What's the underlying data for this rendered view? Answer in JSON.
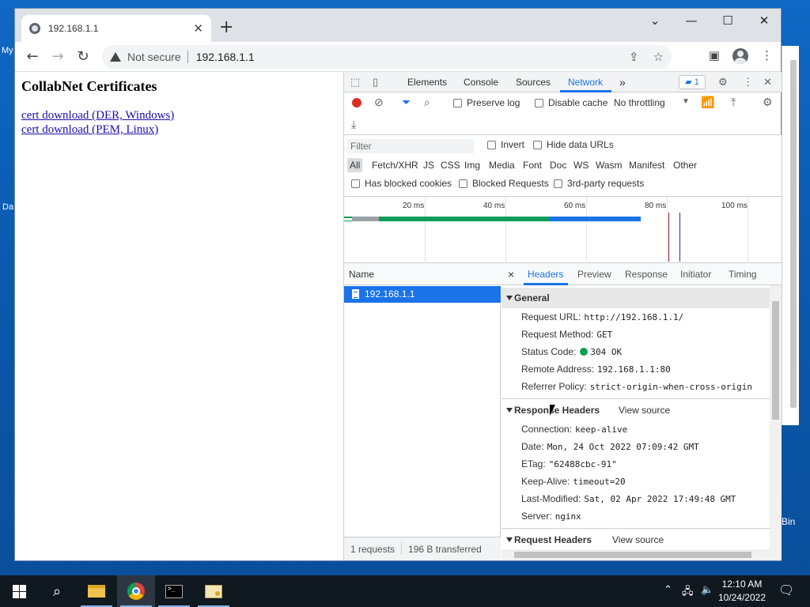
{
  "desktop": {
    "icon_labels": [
      "My",
      "Da",
      "Bin"
    ]
  },
  "browser": {
    "tab_title": "192.168.1.1",
    "new_tab_label": "+",
    "window_controls": {
      "minimize": "—",
      "maximize": "☐",
      "close": "✕",
      "tab_search": "⌄"
    },
    "security_label": "Not secure",
    "url": "192.168.1.1"
  },
  "page": {
    "heading": "CollabNet Certificates",
    "links": [
      "cert download (DER, Windows)",
      "cert download (PEM, Linux)"
    ]
  },
  "devtools": {
    "panels": [
      "Elements",
      "Console",
      "Sources",
      "Network"
    ],
    "active_panel": "Network",
    "more_panels": "»",
    "issues_count": "1",
    "toolbar": {
      "preserve_log": "Preserve log",
      "disable_cache": "Disable cache",
      "throttling": "No throttling"
    },
    "filter": {
      "placeholder": "Filter",
      "invert": "Invert",
      "hide_data_urls": "Hide data URLs",
      "types": [
        "All",
        "Fetch/XHR",
        "JS",
        "CSS",
        "Img",
        "Media",
        "Font",
        "Doc",
        "WS",
        "Wasm",
        "Manifest",
        "Other"
      ],
      "has_blocked_cookies": "Has blocked cookies",
      "blocked_requests": "Blocked Requests",
      "third_party": "3rd-party requests"
    },
    "timeline": {
      "ticks": [
        "20 ms",
        "40 ms",
        "60 ms",
        "80 ms",
        "100 ms"
      ],
      "colors": {
        "green": "#0f9d58",
        "blue": "#1a73e8",
        "grey": "#9aa0a6",
        "red": "#8b1a1a",
        "navy": "#1f3a93"
      }
    },
    "list": {
      "column_name": "Name",
      "rows": [
        "192.168.1.1"
      ],
      "footer": {
        "requests": "1 requests",
        "transferred": "196 B transferred"
      }
    },
    "details": {
      "close": "×",
      "tabs": [
        "Headers",
        "Preview",
        "Response",
        "Initiator",
        "Timing"
      ],
      "active_tab": "Headers",
      "general": {
        "title": "General",
        "rows": [
          {
            "k": "Request URL:",
            "v": "http://192.168.1.1/"
          },
          {
            "k": "Request Method:",
            "v": "GET"
          },
          {
            "k": "Status Code:",
            "v": "304 OK"
          },
          {
            "k": "Remote Address:",
            "v": "192.168.1.1:80"
          },
          {
            "k": "Referrer Policy:",
            "v": "strict-origin-when-cross-origin"
          }
        ]
      },
      "response_headers": {
        "title": "Response Headers",
        "view_source": "View source",
        "rows": [
          {
            "k": "Connection:",
            "v": "keep-alive"
          },
          {
            "k": "Date:",
            "v": "Mon, 24 Oct 2022 07:09:42 GMT"
          },
          {
            "k": "ETag:",
            "v": "\"62488cbc-91\""
          },
          {
            "k": "Keep-Alive:",
            "v": "timeout=20"
          },
          {
            "k": "Last-Modified:",
            "v": "Sat, 02 Apr 2022 17:49:48 GMT"
          },
          {
            "k": "Server:",
            "v": "nginx"
          }
        ]
      },
      "request_headers": {
        "title": "Request Headers",
        "view_source": "View source"
      }
    }
  },
  "taskbar": {
    "time": "12:10 AM",
    "date": "10/24/2022"
  }
}
